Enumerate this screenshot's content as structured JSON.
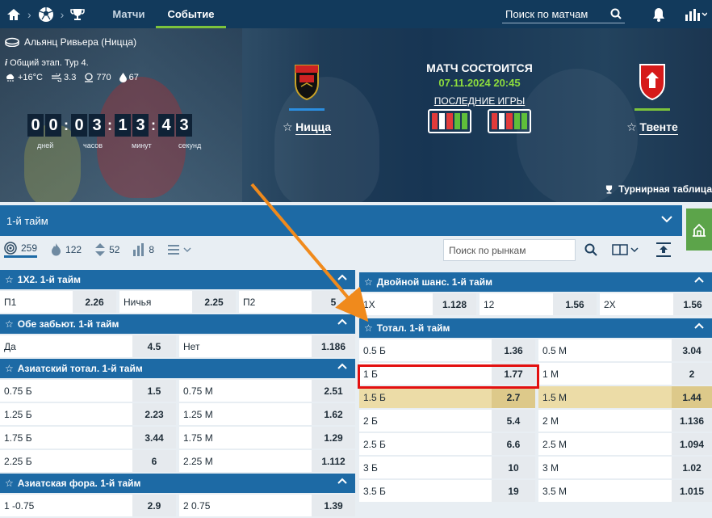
{
  "nav": {
    "tabs": [
      "Матчи",
      "Событие"
    ],
    "active_tab": "Событие",
    "search_label": "Поиск по матчам"
  },
  "event": {
    "venue": "Альянц Ривьера (Ницца)",
    "stage": "Общий этап. Тур 4.",
    "weather": {
      "temp": "+16°C",
      "wind": "3.3",
      "pressure": "770",
      "humidity": "67"
    },
    "countdown": {
      "digits": [
        "0",
        "0",
        "0",
        "3",
        "1",
        "3",
        "4",
        "3"
      ],
      "labels": [
        "дней",
        "часов",
        "минут",
        "секунд"
      ]
    },
    "status": "МАТЧ СОСТОИТСЯ",
    "datetime": "07.11.2024 20:45",
    "last_games": "ПОСЛЕДНИЕ ИГРЫ",
    "home": {
      "name": "Ницца",
      "bar_color": "#2b8ee0",
      "form": [
        "#e23b3b",
        "#ffffff",
        "#e23b3b",
        "#5fbf3a",
        "#5fbf3a"
      ]
    },
    "away": {
      "name": "Твенте",
      "bar_color": "#7cc33c",
      "form": [
        "#e23b3b",
        "#ffffff",
        "#e23b3b",
        "#5fbf3a",
        "#5fbf3a"
      ]
    },
    "standings_label": "Турнирная таблица"
  },
  "period_label": "1-й тайм",
  "filters": {
    "counts": [
      "259",
      "122",
      "52",
      "8"
    ],
    "market_search": "Поиск по рынкам"
  },
  "left_markets": [
    {
      "title": "1X2. 1-й тайм",
      "rows": [
        [
          [
            "П1",
            "2.26"
          ],
          [
            "Ничья",
            "2.25"
          ],
          [
            "П2",
            "5"
          ]
        ]
      ]
    },
    {
      "title": "Обе забьют. 1-й тайм",
      "rows": [
        [
          [
            "Да",
            "4.5"
          ],
          [
            "Нет",
            "1.186"
          ]
        ]
      ]
    },
    {
      "title": "Азиатский тотал. 1-й тайм",
      "rows": [
        [
          [
            "0.75 Б",
            "1.5"
          ],
          [
            "0.75 М",
            "2.51"
          ]
        ],
        [
          [
            "1.25 Б",
            "2.23"
          ],
          [
            "1.25 М",
            "1.62"
          ]
        ],
        [
          [
            "1.75 Б",
            "3.44"
          ],
          [
            "1.75 М",
            "1.29"
          ]
        ],
        [
          [
            "2.25 Б",
            "6"
          ],
          [
            "2.25 М",
            "1.112"
          ]
        ]
      ]
    },
    {
      "title": "Азиатская фора. 1-й тайм",
      "rows": [
        [
          [
            "1 -0.75",
            "2.9"
          ],
          [
            "2 0.75",
            "1.39"
          ]
        ]
      ]
    }
  ],
  "right_markets": [
    {
      "title": "Двойной шанс. 1-й тайм",
      "rows": [
        [
          [
            "1X",
            "1.128"
          ],
          [
            "12",
            "1.56"
          ],
          [
            "2X",
            "1.56"
          ]
        ]
      ]
    },
    {
      "title": "Тотал. 1-й тайм",
      "rows": [
        [
          [
            "0.5 Б",
            "1.36"
          ],
          [
            "0.5 М",
            "3.04"
          ]
        ],
        [
          [
            "1 Б",
            "1.77"
          ],
          [
            "1 М",
            "2"
          ]
        ],
        [
          [
            "1.5 Б",
            "2.7"
          ],
          [
            "1.5 М",
            "1.44"
          ]
        ],
        [
          [
            "2 Б",
            "5.4"
          ],
          [
            "2 М",
            "1.136"
          ]
        ],
        [
          [
            "2.5 Б",
            "6.6"
          ],
          [
            "2.5 М",
            "1.094"
          ]
        ],
        [
          [
            "3 Б",
            "10"
          ],
          [
            "3 М",
            "1.02"
          ]
        ],
        [
          [
            "3.5 Б",
            "19"
          ],
          [
            "3.5 М",
            "1.015"
          ]
        ]
      ],
      "highlight_row": 2
    }
  ],
  "colors": {
    "accent": "#1d6aa5",
    "nav": "#123a5c",
    "highlight": "#ecdca7",
    "annotation_arrow": "#f08a1c",
    "annotation_box": "#e31010"
  }
}
